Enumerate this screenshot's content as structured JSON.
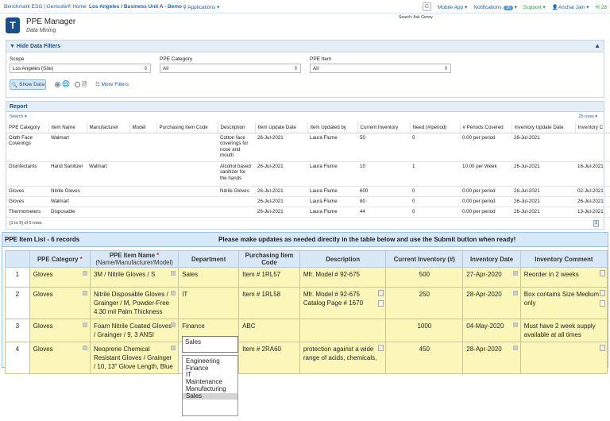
{
  "topbar": {
    "brand": "Benchmark ESG | Gensuite® Home",
    "site": "Los Angeles / Business Unit A - Demo",
    "apps": "Applications",
    "mobile": "Mobile App",
    "notifications": "Notifications",
    "notif_count": "16",
    "support": "Support",
    "user": "Anchal Jain",
    "count2": "28",
    "ask": "Search: Ask Genny"
  },
  "page": {
    "title": "PPE Manager",
    "subtitle": "Data Mining"
  },
  "filters": {
    "header": "Hide Data Filters",
    "scope_label": "Scope",
    "scope_value": "Los Angeles (Site)",
    "category_label": "PPE Category",
    "category_value": "All",
    "item_label": "PPE Item",
    "item_value": "All",
    "show_data": "Show Data",
    "more_filters": "More Filters"
  },
  "report": {
    "title": "Report",
    "search": "Search",
    "rows_per_page": "25 rows",
    "columns": [
      "PPE Category",
      "Item Name",
      "Manufacturer",
      "Model",
      "Purchasing Item Code",
      "Description",
      "Item Update Date",
      "Item Updated by",
      "Current Inventory",
      "Need (#/period)",
      "# Periods Covered",
      "Inventory Update Date",
      "Inventory C"
    ],
    "rows": [
      [
        "Cloth Face Coverings",
        "Walmart",
        "",
        "",
        "",
        "Cotton face coverings for nose and mouth",
        "26-Jul-2021",
        "Laura Flume",
        "50",
        "0",
        "0.00 per period",
        "26-Jul-2021",
        ""
      ],
      [
        "Disinfectants",
        "Hand Sanitizer",
        "Walmart",
        "",
        "",
        "Alcohol based sanitizer for the hands",
        "26-Jul-2021",
        "Laura Flume",
        "10",
        "1",
        "10.00 per Week",
        "26-Jul-2021",
        "16-Jul-2021"
      ],
      [
        "Gloves",
        "Nitrile Gloves",
        "",
        "",
        "",
        "Nitrile Gloves",
        "26-Jul-2021",
        "Laura Flume",
        "600",
        "0",
        "0.00 per period",
        "26-Jul-2021",
        "02-Jul-2021"
      ],
      [
        "Gloves",
        "Walmart",
        "",
        "",
        "",
        "",
        "26-Jul-2021",
        "Laura Flume",
        "80",
        "0",
        "0.00 per period",
        "26-Jul-2021",
        "26-Jul-2021"
      ],
      [
        "Thermometers",
        "Disposable",
        "",
        "",
        "",
        "",
        "26-Jul-2021",
        "Laura Flume",
        "44",
        "0",
        "0.00 per period",
        "26-Jul-2021",
        "13-Jul-2021"
      ]
    ],
    "footer": "[1 to 5] of 5 rows",
    "page": "1"
  },
  "modal": {
    "title": "PPE Item List - 6 records",
    "message": "Please make updates as needed directly in the table below and use the Submit button when ready!",
    "columns": {
      "category": "PPE Category",
      "item_name": "PPE Item Name",
      "item_name_sub": "(Name/Manufacturer/Model)",
      "department": "Department",
      "code": "Purchasing Item Code",
      "description": "Description",
      "inventory": "Current Inventory (#)",
      "date": "Inventory Date",
      "comment": "Inventory Comment"
    },
    "rows": [
      {
        "n": "1",
        "category": "Gloves",
        "item": "3M / Nitrile Gloves / S",
        "dept": "Sales",
        "code": "Item # 1RL57",
        "desc": "Mfr. Model # 92-675",
        "inv": "500",
        "date": "27-Apr-2020",
        "comment": "Reorder in 2 weeks"
      },
      {
        "n": "2",
        "category": "Gloves",
        "item": "Nitrile Disposable Gloves / Grainger / M, Powder-Free 4.30 mil Palm Thickness",
        "dept": "IT",
        "code": "Item # 1RL58",
        "desc": "Mfr. Model # 92-675 Catalog Page # 1670",
        "inv": "250",
        "date": "28-Apr-2020",
        "comment": "Box contains Size Medium only"
      },
      {
        "n": "3",
        "category": "Gloves",
        "item": "Foam Nitrile Coated Gloves / Grainger / 9, 3 ANSI",
        "dept": "Finance",
        "code": "ABC",
        "desc": "",
        "inv": "1000",
        "date": "04-May-2020",
        "comment": "Must have 2 week supply available at all times"
      },
      {
        "n": "4",
        "category": "Gloves",
        "item": "Neoprene Chemical Resistant Gloves / Grainger / 10, 13\" Glove Length, Blue",
        "dept": "",
        "code": "Item # 2RA60",
        "desc": "protection against a wide range of acids, chemicals,",
        "inv": "450",
        "date": "28-Apr-2020",
        "comment": ""
      }
    ],
    "dept_input": "Sales",
    "dept_options": [
      "Engineering",
      "Finance",
      "IT",
      "Maintenance",
      "Manufacturing",
      "Sales"
    ]
  }
}
